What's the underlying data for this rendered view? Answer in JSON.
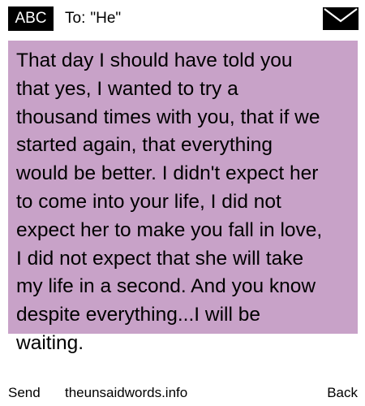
{
  "header": {
    "mode": "ABC",
    "to_label": "To:",
    "recipient": "\"He\"",
    "icon": "envelope-icon"
  },
  "message": {
    "lines": [
      "That day I should have told you",
      "that yes, I wanted to try a",
      "thousand times with you, that if we",
      "started again, that everything",
      "would be better. I didn't expect her",
      "to come into your life, I did not",
      "expect her to make you fall in love,",
      "I did not expect that she will take",
      "my life in a second. And you know",
      "despite everything...I will be",
      "waiting."
    ]
  },
  "softkeys": {
    "left": "Send",
    "center": "theunsaidwords.info",
    "right": "Back"
  },
  "colors": {
    "message_background": "#c8a2c8",
    "badge_background": "#000000",
    "page_background": "#ffffff"
  }
}
